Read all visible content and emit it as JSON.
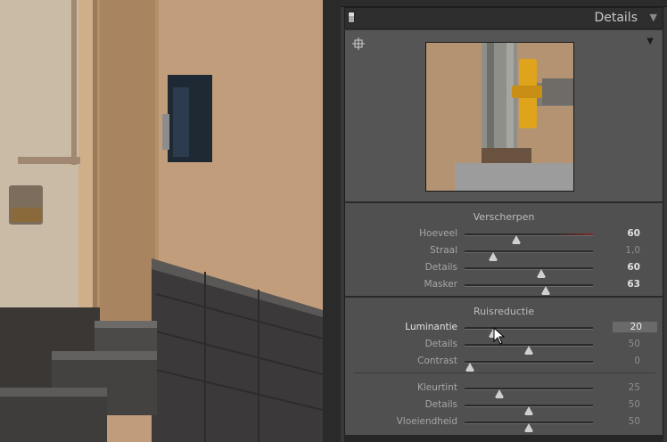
{
  "panel": {
    "title": "Details",
    "sections": {
      "sharpen": {
        "title": "Verscherpen",
        "rows": [
          {
            "label": "Hoeveel",
            "value": "60",
            "fraction": 0.4
          },
          {
            "label": "Straal",
            "value": "1,0",
            "fraction": 0.22
          },
          {
            "label": "Details",
            "value": "60",
            "fraction": 0.6
          },
          {
            "label": "Masker",
            "value": "63",
            "fraction": 0.63
          }
        ]
      },
      "noise": {
        "title": "Ruisreductie",
        "rows": [
          {
            "label": "Luminantie",
            "value": "20",
            "fraction": 0.22
          },
          {
            "label": "Details",
            "value": "50",
            "fraction": 0.5
          },
          {
            "label": "Contrast",
            "value": "0",
            "fraction": 0.04
          },
          {
            "label": "Kleurtint",
            "value": "25",
            "fraction": 0.27
          },
          {
            "label": "Details",
            "value": "50",
            "fraction": 0.5
          },
          {
            "label": "Vloeiendheid",
            "value": "50",
            "fraction": 0.5
          }
        ]
      }
    }
  },
  "colors": {
    "panel_bg": "#505050",
    "preview_bg": "#555555",
    "active_value_bg": "#6a6a6a",
    "wall": "#c19c7c",
    "pipe_handle": "#e0a41c"
  }
}
